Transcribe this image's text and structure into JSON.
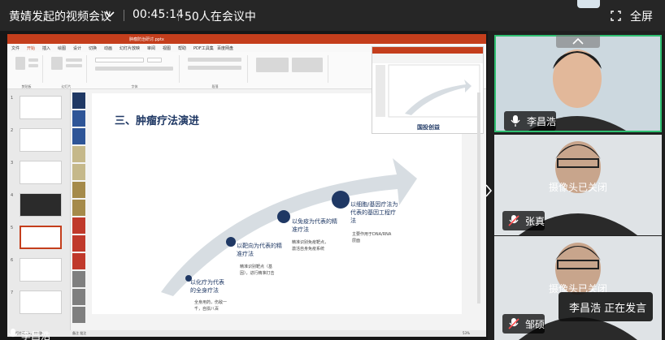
{
  "topbar": {
    "meeting_title": "黄婧发起的视频会议",
    "elapsed": "00:45:14",
    "participants": "50人在会议中",
    "fullscreen_label": "全屏"
  },
  "ppt": {
    "window_title": "肿瘤防治研讨.pptx",
    "menu": [
      "文件",
      "开始",
      "插入",
      "绘图",
      "设计",
      "切换",
      "动画",
      "幻灯片放映",
      "审阅",
      "视图",
      "帮助",
      "PDF工具集",
      "百度网盘"
    ],
    "groups": [
      "剪贴板",
      "幻灯片",
      "字体",
      "段落"
    ],
    "status_left": "幻灯片第5张，共9张",
    "status_right": "备注  批注",
    "zoom": "53%",
    "thumb_numbers": [
      "1",
      "2",
      "3",
      "4",
      "5",
      "6",
      "7"
    ]
  },
  "slide": {
    "heading": "三、肿瘤疗法演进",
    "stage1_title": "以化疗为代表的全身疗法",
    "stage1_detail": "全身用药，伤敌一千，自损八百",
    "stage2_title": "以靶向为代表的精准疗法",
    "stage2_detail": "精准识别靶点（基因），进行精准打击",
    "stage3_title": "以免疫为代表的精准疗法",
    "stage3_detail": "精准识别免疫靶点，激活自身免疫系统",
    "stage4_title": "以细胞/基因疗法为代表的基因工程疗法",
    "stage4_detail": "主要作用于DNA/RNA层面",
    "pip_label": "国投创益"
  },
  "participants": {
    "speaker_name": "李昌浩",
    "p2_name": "张真",
    "p2_status": "摄像头已关闭",
    "p3_name": "邹硕",
    "p3_status": "摄像头已关闭"
  },
  "speaking_now": "李昌浩  正在发言",
  "self_name": "李昌浩",
  "colors": {
    "active_border": "#2fbf71",
    "ppt_accent": "#c43e1c",
    "slide_text": "#1f3864",
    "arrow": "#d7dde2"
  }
}
